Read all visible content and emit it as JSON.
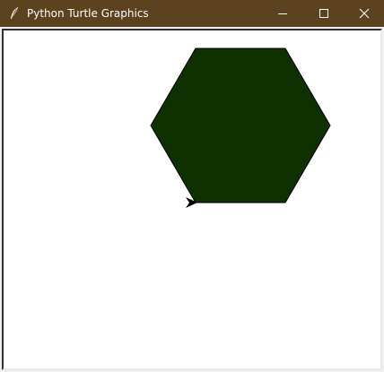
{
  "window": {
    "title": "Python Turtle Graphics",
    "app_icon": "feather-icon",
    "controls": {
      "minimize": "minimize-icon",
      "maximize": "maximize-icon",
      "close": "close-icon"
    }
  },
  "canvas": {
    "background": "#ffffff",
    "shape": {
      "kind": "hexagon",
      "fill_color": "#0f3000",
      "outline_color": "#000000"
    },
    "turtle": {
      "icon": "turtle-arrow-icon",
      "color": "#000000"
    }
  },
  "colors": {
    "titlebar": "#5c421f",
    "titlebar_text": "#ffffff"
  }
}
